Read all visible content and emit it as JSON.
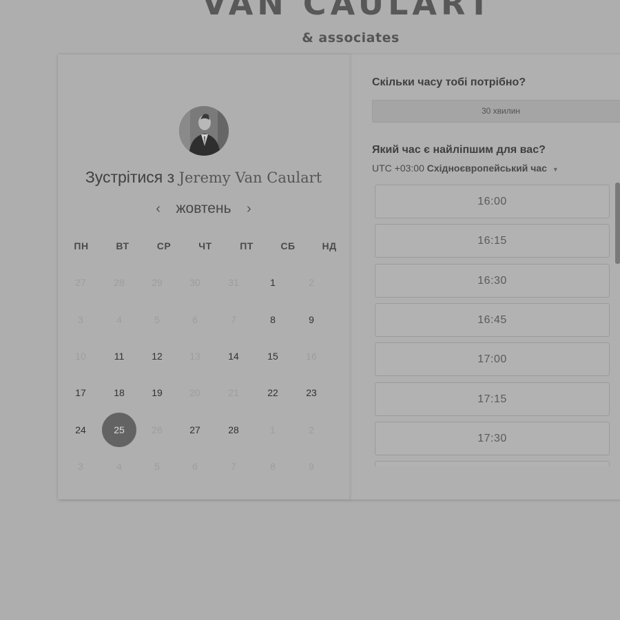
{
  "brand": {
    "title": "VAN CAULART",
    "subtitle": "& associates"
  },
  "booking": {
    "title_prefix": "Зустрітися з",
    "host_name": "Jeremy Van Caulart",
    "month": "жовтень",
    "prev_icon": "chevron-left-icon",
    "next_icon": "chevron-right-icon"
  },
  "calendar": {
    "weekdays": [
      "ПН",
      "ВТ",
      "СР",
      "ЧТ",
      "ПТ",
      "СБ",
      "НД"
    ],
    "weeks": [
      [
        {
          "d": "27",
          "s": "muted"
        },
        {
          "d": "28",
          "s": "muted"
        },
        {
          "d": "29",
          "s": "muted"
        },
        {
          "d": "30",
          "s": "muted"
        },
        {
          "d": "31",
          "s": "muted"
        },
        {
          "d": "1",
          "s": "active"
        },
        {
          "d": "2",
          "s": "muted"
        }
      ],
      [
        {
          "d": "3",
          "s": "muted"
        },
        {
          "d": "4",
          "s": "muted"
        },
        {
          "d": "5",
          "s": "muted"
        },
        {
          "d": "6",
          "s": "muted"
        },
        {
          "d": "7",
          "s": "muted"
        },
        {
          "d": "8",
          "s": "active"
        },
        {
          "d": "9",
          "s": "active"
        }
      ],
      [
        {
          "d": "10",
          "s": "muted"
        },
        {
          "d": "11",
          "s": "active"
        },
        {
          "d": "12",
          "s": "active"
        },
        {
          "d": "13",
          "s": "muted"
        },
        {
          "d": "14",
          "s": "active"
        },
        {
          "d": "15",
          "s": "active"
        },
        {
          "d": "16",
          "s": "muted"
        }
      ],
      [
        {
          "d": "17",
          "s": "active"
        },
        {
          "d": "18",
          "s": "active"
        },
        {
          "d": "19",
          "s": "active"
        },
        {
          "d": "20",
          "s": "muted"
        },
        {
          "d": "21",
          "s": "muted"
        },
        {
          "d": "22",
          "s": "active"
        },
        {
          "d": "23",
          "s": "active"
        }
      ],
      [
        {
          "d": "24",
          "s": "active"
        },
        {
          "d": "25",
          "s": "selected"
        },
        {
          "d": "26",
          "s": "muted"
        },
        {
          "d": "27",
          "s": "active"
        },
        {
          "d": "28",
          "s": "active"
        },
        {
          "d": "1",
          "s": "muted"
        },
        {
          "d": "2",
          "s": "muted"
        }
      ],
      [
        {
          "d": "3",
          "s": "muted"
        },
        {
          "d": "4",
          "s": "muted"
        },
        {
          "d": "5",
          "s": "muted"
        },
        {
          "d": "6",
          "s": "muted"
        },
        {
          "d": "7",
          "s": "muted"
        },
        {
          "d": "8",
          "s": "muted"
        },
        {
          "d": "9",
          "s": "muted"
        }
      ]
    ]
  },
  "scheduling": {
    "duration_question": "Скільки часу тобі потрібно?",
    "duration_value": "30 хвилин",
    "time_question": "Який час є найліпшим для вас?",
    "timezone_offset": "UTC +03:00",
    "timezone_name": "Східноєвропейський час",
    "timezone_caret_icon": "caret-down-icon",
    "time_slots": [
      "16:00",
      "16:15",
      "16:30",
      "16:45",
      "17:00",
      "17:15",
      "17:30",
      ""
    ]
  },
  "colors": {
    "selected_day": "#636363",
    "background": "#aeaeae"
  }
}
